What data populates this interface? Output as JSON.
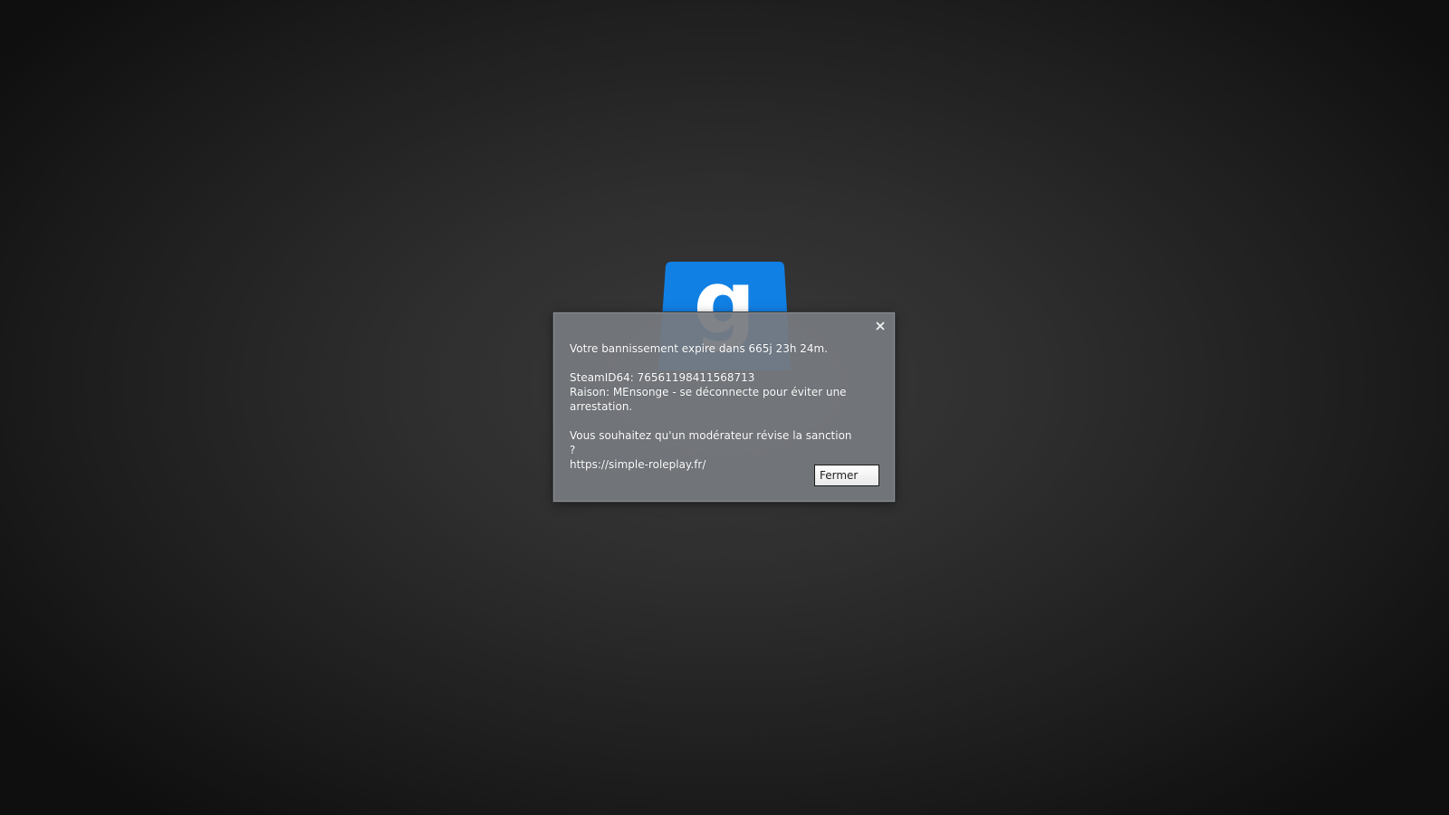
{
  "background": {
    "logo_letter": "g",
    "logo_color": "#1180e4"
  },
  "dialog": {
    "close_icon": "close-icon",
    "lines": [
      "Votre bannissement expire dans 665j 23h 24m.",
      "",
      "SteamID64: 76561198411568713",
      "Raison: MEnsonge - se déconnecte pour éviter une",
      "arrestation.",
      "",
      "Vous souhaitez qu'un modérateur révise la sanction ?",
      "https://simple-roleplay.fr/"
    ],
    "close_button_label": "Fermer"
  },
  "colors": {
    "dialog_bg": "#767a7f",
    "logo_blue": "#1180e4",
    "text": "#ffffff"
  }
}
